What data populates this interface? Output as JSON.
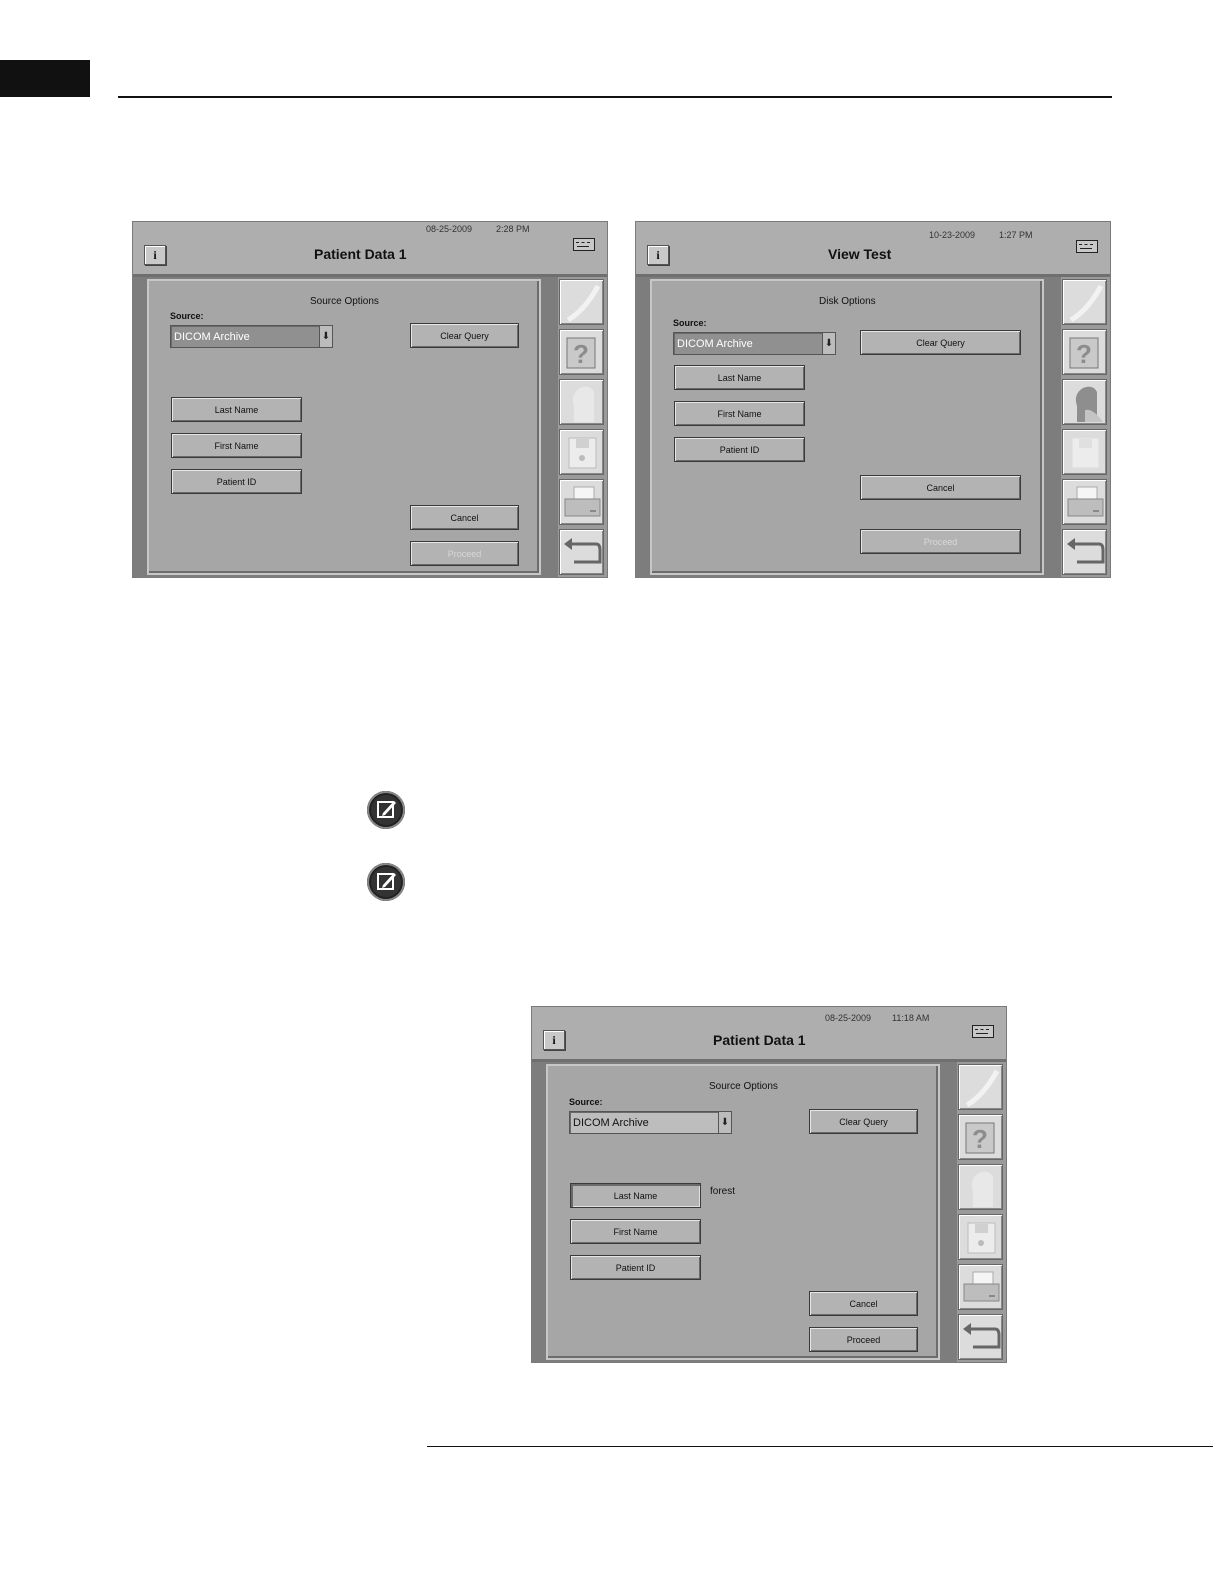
{
  "screens": [
    {
      "date": "08-25-2009",
      "time": "2:28 PM",
      "title": "Patient Data 1",
      "panel_title": "Source Options",
      "source_label": "Source:",
      "source_value": "DICOM Archive",
      "buttons": {
        "clear_query": "Clear Query",
        "last_name": "Last Name",
        "first_name": "First Name",
        "patient_id": "Patient ID",
        "cancel": "Cancel",
        "proceed": "Proceed"
      },
      "last_name_value": ""
    },
    {
      "date": "10-23-2009",
      "time": "1:27 PM",
      "title": "View Test",
      "panel_title": "Disk Options",
      "source_label": "Source:",
      "source_value": "DICOM Archive",
      "buttons": {
        "clear_query": "Clear Query",
        "last_name": "Last Name",
        "first_name": "First Name",
        "patient_id": "Patient ID",
        "cancel": "Cancel",
        "proceed": "Proceed"
      }
    },
    {
      "date": "08-25-2009",
      "time": "11:18 AM",
      "title": "Patient Data 1",
      "panel_title": "Source Options",
      "source_label": "Source:",
      "source_value": "DICOM Archive",
      "buttons": {
        "clear_query": "Clear Query",
        "last_name": "Last Name",
        "first_name": "First Name",
        "patient_id": "Patient ID",
        "cancel": "Cancel",
        "proceed": "Proceed"
      },
      "last_name_value": "forest"
    }
  ],
  "icons": {
    "info": "i",
    "keyboard": "keyboard-icon",
    "side": [
      "blank-icon",
      "help-icon",
      "patient-head-icon",
      "floppy-disk-icon",
      "printer-icon",
      "return-arrow-icon"
    ],
    "help_glyph": "?",
    "note": "note-pencil-icon"
  }
}
